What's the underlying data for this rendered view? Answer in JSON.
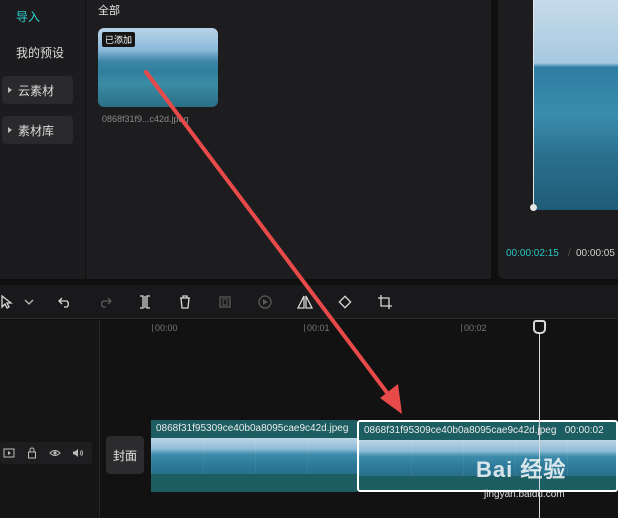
{
  "sidebar": {
    "items": [
      {
        "label": "导入"
      },
      {
        "label": "我的预设"
      },
      {
        "label": "云素材"
      },
      {
        "label": "素材库"
      }
    ]
  },
  "media": {
    "heading": "全部",
    "thumb": {
      "badge": "已添加",
      "filename": "0868f31f9...c42d.jpeg"
    }
  },
  "preview": {
    "current_time": "00:00:02:15",
    "separator": "/",
    "total_time": "00:00:05"
  },
  "timeline": {
    "ruler": [
      "00:00",
      "00:01",
      "00:02"
    ],
    "cover_label": "封面",
    "clips": [
      {
        "title": "0868f31f95309ce40b0a8095cae9c42d.jpeg"
      },
      {
        "title": "0868f31f95309ce40b0a8095cae9c42d.jpeg",
        "duration": "00:00:02"
      }
    ]
  },
  "toolbar": {
    "icons": [
      "select-cursor-icon",
      "chevron-down-icon",
      "undo-icon",
      "redo-icon",
      "split-icon",
      "delete-icon",
      "freeze-icon",
      "play-circle-icon",
      "mirror-icon",
      "rotate-icon",
      "crop-icon"
    ]
  },
  "watermark": {
    "brand": "Bai 经验",
    "url": "jingyan.baidu.com"
  },
  "colors": {
    "accent": "#27c6c6",
    "clip": "#1c5d61",
    "arrow": "#e84a4a"
  }
}
